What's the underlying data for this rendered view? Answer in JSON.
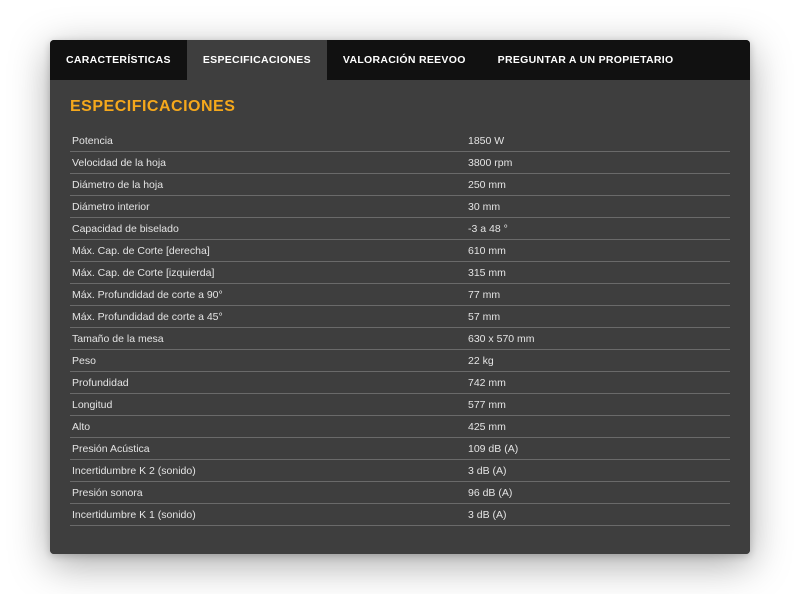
{
  "tabs": [
    {
      "label": "CARACTERÍSTICAS",
      "active": false
    },
    {
      "label": "ESPECIFICACIONES",
      "active": true
    },
    {
      "label": "VALORACIÓN REEVOO",
      "active": false
    },
    {
      "label": "PREGUNTAR A UN PROPIETARIO",
      "active": false
    }
  ],
  "heading": "ESPECIFICACIONES",
  "specs": [
    {
      "label": "Potencia",
      "value": "1850 W"
    },
    {
      "label": "Velocidad de la hoja",
      "value": "3800 rpm"
    },
    {
      "label": "Diámetro de la hoja",
      "value": "250 mm"
    },
    {
      "label": "Diámetro interior",
      "value": "30 mm"
    },
    {
      "label": "Capacidad de biselado",
      "value": "-3 a 48 °"
    },
    {
      "label": "Máx. Cap. de Corte [derecha]",
      "value": "610 mm"
    },
    {
      "label": "Máx. Cap. de Corte [izquierda]",
      "value": "315 mm"
    },
    {
      "label": "Máx. Profundidad de corte a 90°",
      "value": "77 mm"
    },
    {
      "label": "Máx. Profundidad de corte a 45°",
      "value": "57 mm"
    },
    {
      "label": "Tamaño de la mesa",
      "value": "630 x 570 mm"
    },
    {
      "label": "Peso",
      "value": "22 kg"
    },
    {
      "label": "Profundidad",
      "value": "742 mm"
    },
    {
      "label": "Longitud",
      "value": "577 mm"
    },
    {
      "label": "Alto",
      "value": "425 mm"
    },
    {
      "label": "Presión Acústica",
      "value": "109 dB (A)"
    },
    {
      "label": "Incertidumbre K 2 (sonido)",
      "value": "3 dB (A)"
    },
    {
      "label": "Presión sonora",
      "value": "96 dB (A)"
    },
    {
      "label": "Incertidumbre K 1 (sonido)",
      "value": "3 dB (A)"
    }
  ]
}
